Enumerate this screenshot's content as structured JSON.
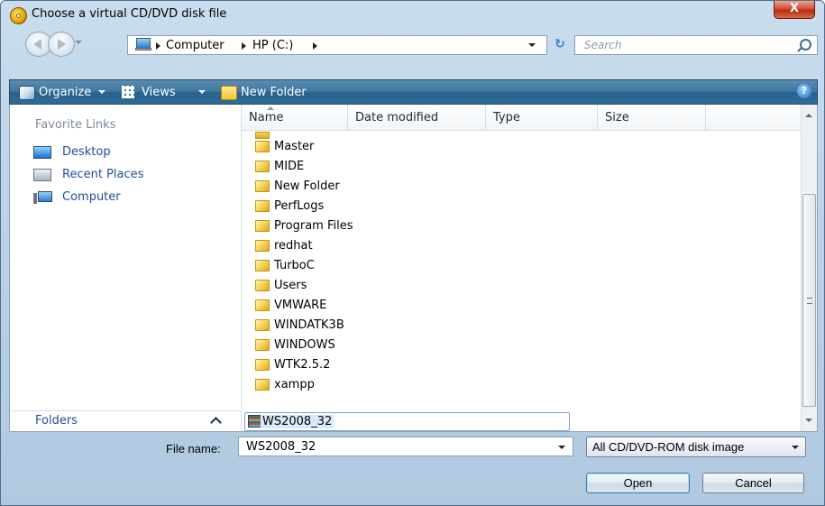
{
  "window": {
    "title": "Choose a virtual CD/DVD disk file",
    "close_glyph": "X"
  },
  "address": {
    "crumbs": [
      "Computer",
      "HP (C:)"
    ],
    "refresh_glyph": "↻"
  },
  "search": {
    "placeholder": "Search"
  },
  "toolbar": {
    "organize": "Organize",
    "views": "Views",
    "new_folder": "New Folder",
    "help_glyph": "?"
  },
  "sidebar": {
    "title": "Favorite Links",
    "items": [
      {
        "label": "Desktop",
        "icon": "desktop-icon"
      },
      {
        "label": "Recent Places",
        "icon": "recent-places-icon"
      },
      {
        "label": "Computer",
        "icon": "computer-icon"
      }
    ],
    "folders_label": "Folders"
  },
  "columns": [
    "Name",
    "Date modified",
    "Type",
    "Size"
  ],
  "files": [
    {
      "name": "Master"
    },
    {
      "name": "MIDE"
    },
    {
      "name": "New Folder"
    },
    {
      "name": "PerfLogs"
    },
    {
      "name": "Program Files"
    },
    {
      "name": "redhat"
    },
    {
      "name": "TurboC"
    },
    {
      "name": "Users"
    },
    {
      "name": "VMWARE"
    },
    {
      "name": "WINDATK3B"
    },
    {
      "name": "WINDOWS"
    },
    {
      "name": "WTK2.5.2"
    },
    {
      "name": "xampp"
    },
    {
      "name": "WS2008_32",
      "selected": true
    }
  ],
  "bottom": {
    "file_name_label": "File name:",
    "file_name_value": "WS2008_32",
    "filter_value": "All CD/DVD-ROM disk image",
    "open_label": "Open",
    "cancel_label": "Cancel"
  },
  "colors": {
    "toolbar": "#3f769e",
    "link": "#1e4f98",
    "selection_border": "#7da2ce"
  }
}
